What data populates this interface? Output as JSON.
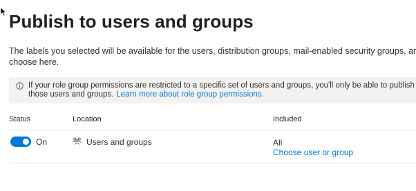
{
  "page": {
    "title": "Publish to users and groups",
    "description_line1": "The labels you selected will be available for the users, distribution groups, mail-enabled security groups, and M",
    "description_line2": "choose here."
  },
  "info_bar": {
    "icon": "info-icon",
    "text_line1": "If your role group permissions are restricted to a specific set of users and groups, you'll only be able to publish labels fo",
    "text_line2": "those users and groups.",
    "link": "Learn more about role group permissions."
  },
  "table": {
    "headers": {
      "status": "Status",
      "location": "Location",
      "included": "Included"
    },
    "rows": [
      {
        "status_on": true,
        "status_label": "On",
        "location_icon": "users-group-icon",
        "location": "Users and groups",
        "included_value": "All",
        "included_link": "Choose user or group"
      }
    ]
  },
  "colors": {
    "accent": "#0078d4",
    "info_background": "#f3f2f1",
    "divider": "#e1dfdd"
  }
}
